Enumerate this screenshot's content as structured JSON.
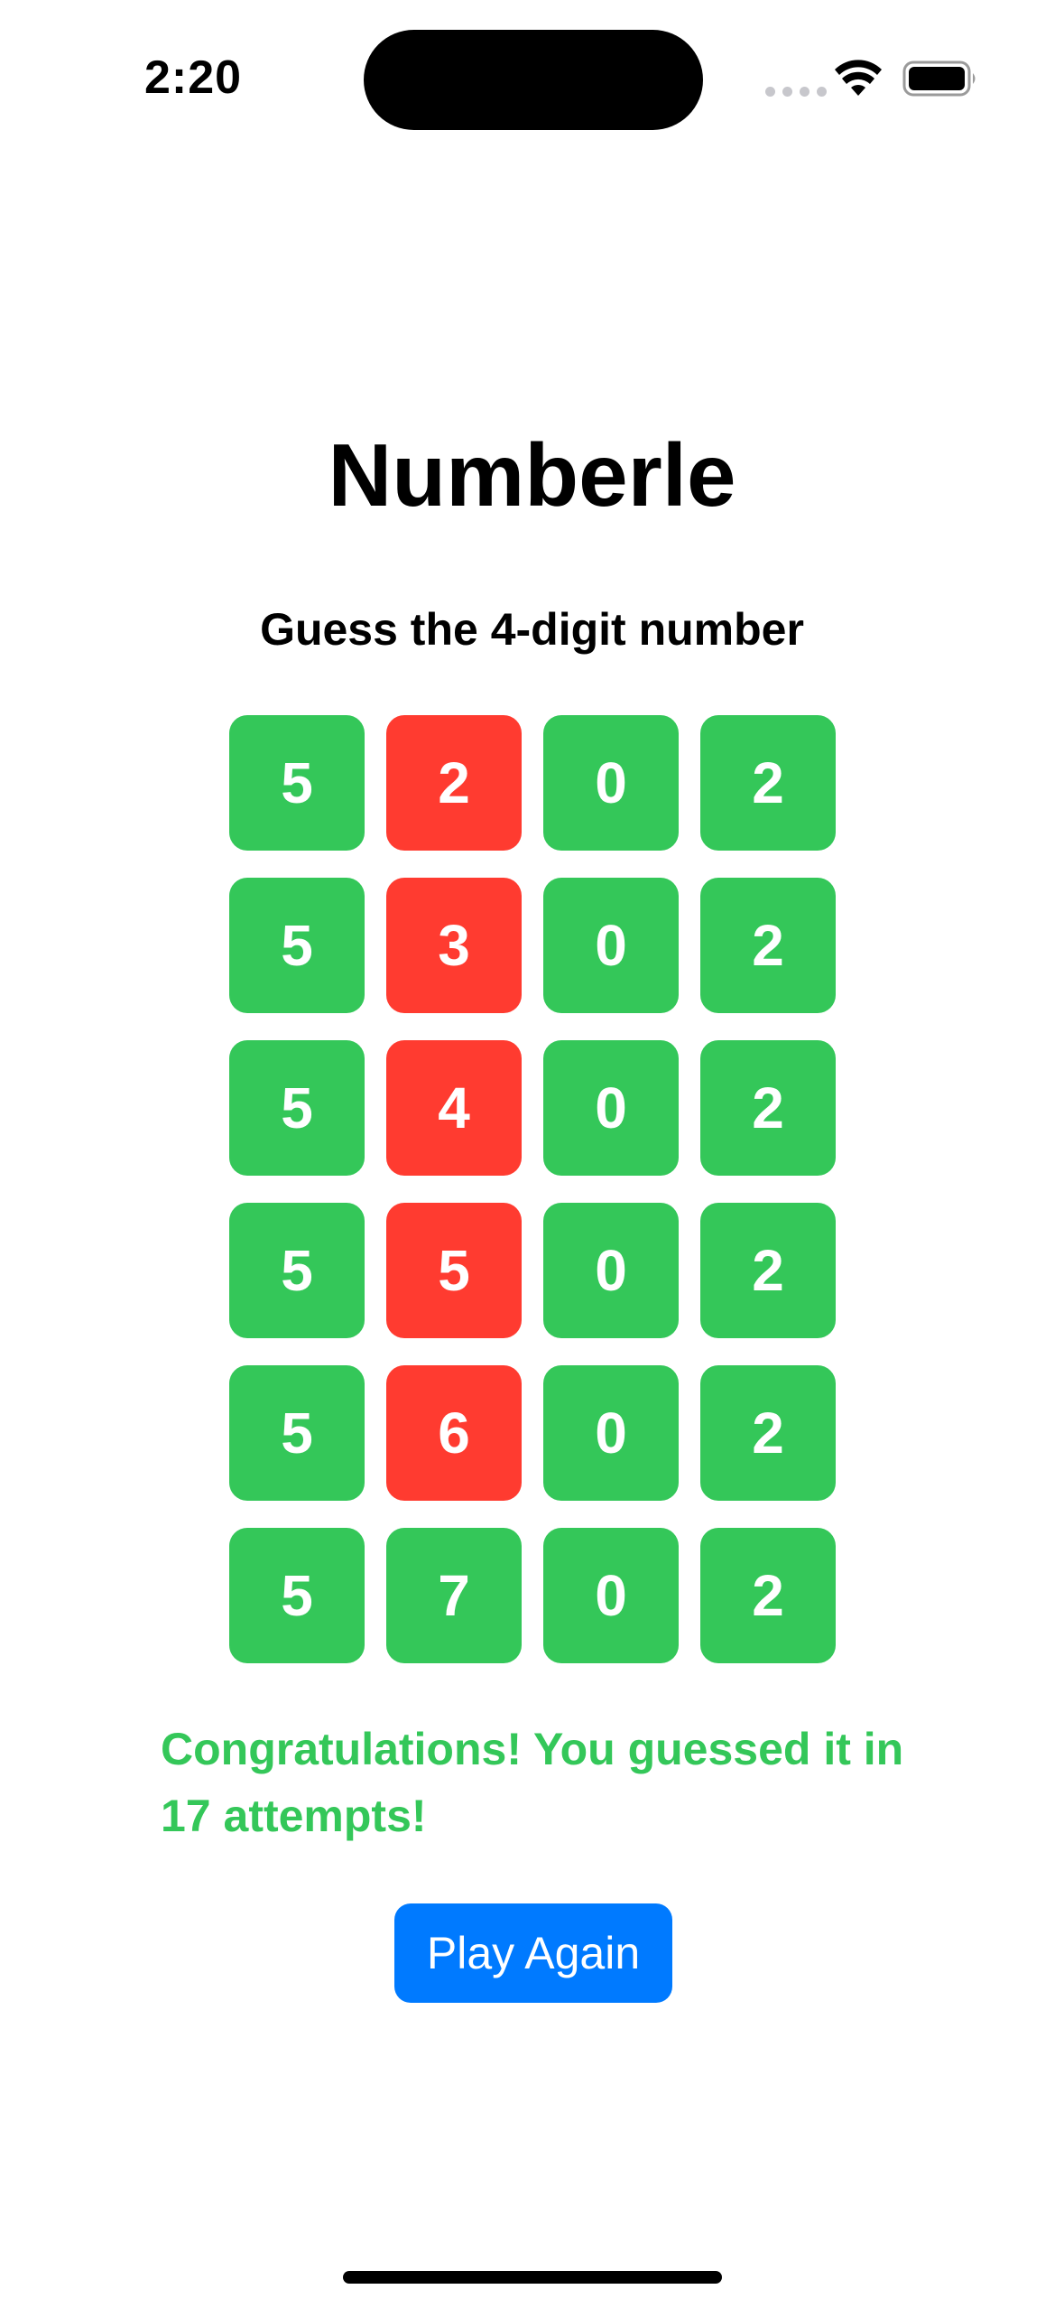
{
  "status_bar": {
    "time": "2:20",
    "icons": [
      "signal-dots-icon",
      "wifi-icon",
      "battery-icon"
    ]
  },
  "game": {
    "title": "Numberle",
    "subtitle": "Guess the 4-digit number",
    "colors": {
      "correct": "#34c759",
      "wrong": "#ff3b30",
      "message": "#34c759",
      "button": "#007aff"
    },
    "guesses": [
      [
        {
          "digit": "5",
          "state": "correct"
        },
        {
          "digit": "2",
          "state": "wrong"
        },
        {
          "digit": "0",
          "state": "correct"
        },
        {
          "digit": "2",
          "state": "correct"
        }
      ],
      [
        {
          "digit": "5",
          "state": "correct"
        },
        {
          "digit": "3",
          "state": "wrong"
        },
        {
          "digit": "0",
          "state": "correct"
        },
        {
          "digit": "2",
          "state": "correct"
        }
      ],
      [
        {
          "digit": "5",
          "state": "correct"
        },
        {
          "digit": "4",
          "state": "wrong"
        },
        {
          "digit": "0",
          "state": "correct"
        },
        {
          "digit": "2",
          "state": "correct"
        }
      ],
      [
        {
          "digit": "5",
          "state": "correct"
        },
        {
          "digit": "5",
          "state": "wrong"
        },
        {
          "digit": "0",
          "state": "correct"
        },
        {
          "digit": "2",
          "state": "correct"
        }
      ],
      [
        {
          "digit": "5",
          "state": "correct"
        },
        {
          "digit": "6",
          "state": "wrong"
        },
        {
          "digit": "0",
          "state": "correct"
        },
        {
          "digit": "2",
          "state": "correct"
        }
      ],
      [
        {
          "digit": "5",
          "state": "correct"
        },
        {
          "digit": "7",
          "state": "correct"
        },
        {
          "digit": "0",
          "state": "correct"
        },
        {
          "digit": "2",
          "state": "correct"
        }
      ]
    ],
    "message": "Congratulations! You guessed it in 17 attempts!",
    "play_again_label": "Play Again"
  }
}
